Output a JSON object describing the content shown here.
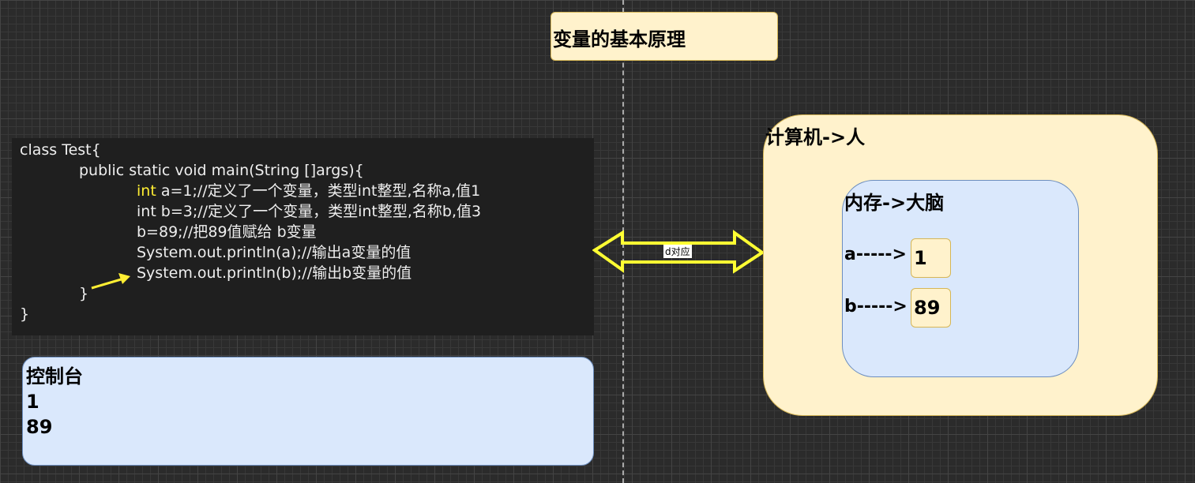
{
  "title": "变量的基本原理",
  "code": {
    "lines": [
      "class Test{",
      "public static void main(String []args){",
      " a=1;//定义了一个变量，类型int整型,名称a,值1",
      "int b=3;//定义了一个变量，类型int整型,名称b,值3",
      "b=89;//把89值赋给 b变量",
      "System.out.println(a);//输出a变量的值",
      "System.out.println(b);//输出b变量的值",
      "}",
      "}"
    ],
    "keyword": "int"
  },
  "console": {
    "title": "控制台",
    "lines": [
      "1",
      "89"
    ]
  },
  "arrow_label": "d对应",
  "computer": {
    "title": "计算机->人",
    "memory": {
      "title": "内存->大脑",
      "vars": [
        {
          "label": "a----->",
          "value": "1"
        },
        {
          "label": "b----->",
          "value": "89"
        }
      ]
    }
  },
  "colors": {
    "yellow_fill": "#fff2cc",
    "blue_fill": "#dae8fc",
    "arrow": "#ffff33"
  }
}
